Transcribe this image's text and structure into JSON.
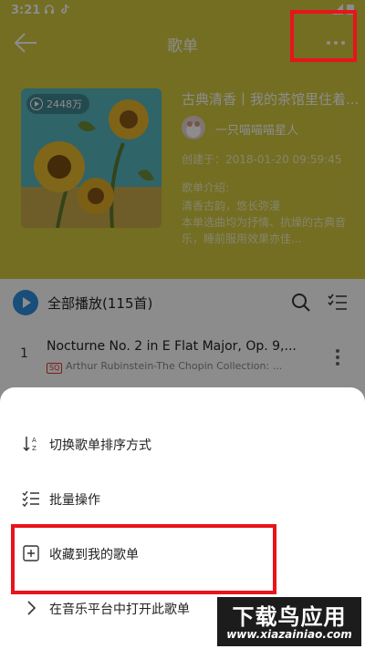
{
  "status_bar": {
    "time": "3:21"
  },
  "header": {
    "title": "歌单"
  },
  "playlist": {
    "play_count": "2448万",
    "title": "古典清香丨我的茶馆里住着...",
    "creator": "一只喵喵喵星人",
    "created_at": "创建于：2018-01-20 09:59:45",
    "intro_label": "歌单介绍:",
    "intro_lines": [
      "清香古韵，悠长弥漫",
      "本单选曲均为抒情、抗燥的古典音",
      "乐，睡前服用效果亦佳..."
    ]
  },
  "list": {
    "play_all_label": "全部播放(115首)",
    "songs": [
      {
        "index": "1",
        "title": "Nocturne No. 2 in E Flat Major, Op. 9,...",
        "badge": "SQ",
        "artist": "Arthur Rubinstein-The Chopin Collection: ..."
      }
    ]
  },
  "sheet": {
    "items": [
      {
        "label": "切换歌单排序方式",
        "icon": "sort-az-icon"
      },
      {
        "label": "批量操作",
        "icon": "checklist-icon"
      },
      {
        "label": "收藏到我的歌单",
        "icon": "add-box-icon"
      },
      {
        "label": "在音乐平台中打开此歌单",
        "icon": "chevron-right-icon"
      }
    ]
  },
  "watermark": {
    "text": "下载鸟应用",
    "url": "www.xiazainiao.com"
  },
  "colors": {
    "header_bg": "#d2c93f",
    "accent": "#2f8fe0",
    "highlight": "#e8141b"
  }
}
